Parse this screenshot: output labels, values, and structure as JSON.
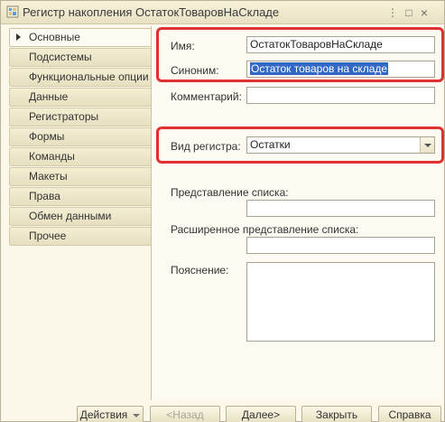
{
  "window": {
    "title": "Регистр накопления ОстатокТоваровНаСкладе",
    "controls": [
      "⋮",
      "□",
      "×"
    ]
  },
  "nav": {
    "items": [
      {
        "label": "Основные",
        "active": true
      },
      {
        "label": "Подсистемы"
      },
      {
        "label": "Функциональные опции"
      },
      {
        "label": "Данные"
      },
      {
        "label": "Регистраторы"
      },
      {
        "label": "Формы"
      },
      {
        "label": "Команды"
      },
      {
        "label": "Макеты"
      },
      {
        "label": "Права"
      },
      {
        "label": "Обмен данными"
      },
      {
        "label": "Прочее"
      }
    ]
  },
  "form": {
    "name_label": "Имя:",
    "name_value": "ОстатокТоваровНаСкладе",
    "synonym_label": "Синоним:",
    "synonym_value": "Остаток товаров на складе",
    "comment_label": "Комментарий:",
    "comment_value": "",
    "register_kind_label": "Вид регистра:",
    "register_kind_value": "Остатки",
    "list_presentation_label": "Представление списка:",
    "list_presentation_value": "",
    "extended_list_presentation_label": "Расширенное представление списка:",
    "extended_list_presentation_value": "",
    "explanation_label": "Пояснение:",
    "explanation_value": ""
  },
  "footer": {
    "actions": "Действия",
    "back": "<Назад",
    "next": "Далее>",
    "close": "Закрыть",
    "help": "Справка"
  },
  "colors": {
    "highlight": "#e03030",
    "selection": "#3168c5",
    "panel": "#fdfbf1",
    "window": "#fbf8e9"
  }
}
